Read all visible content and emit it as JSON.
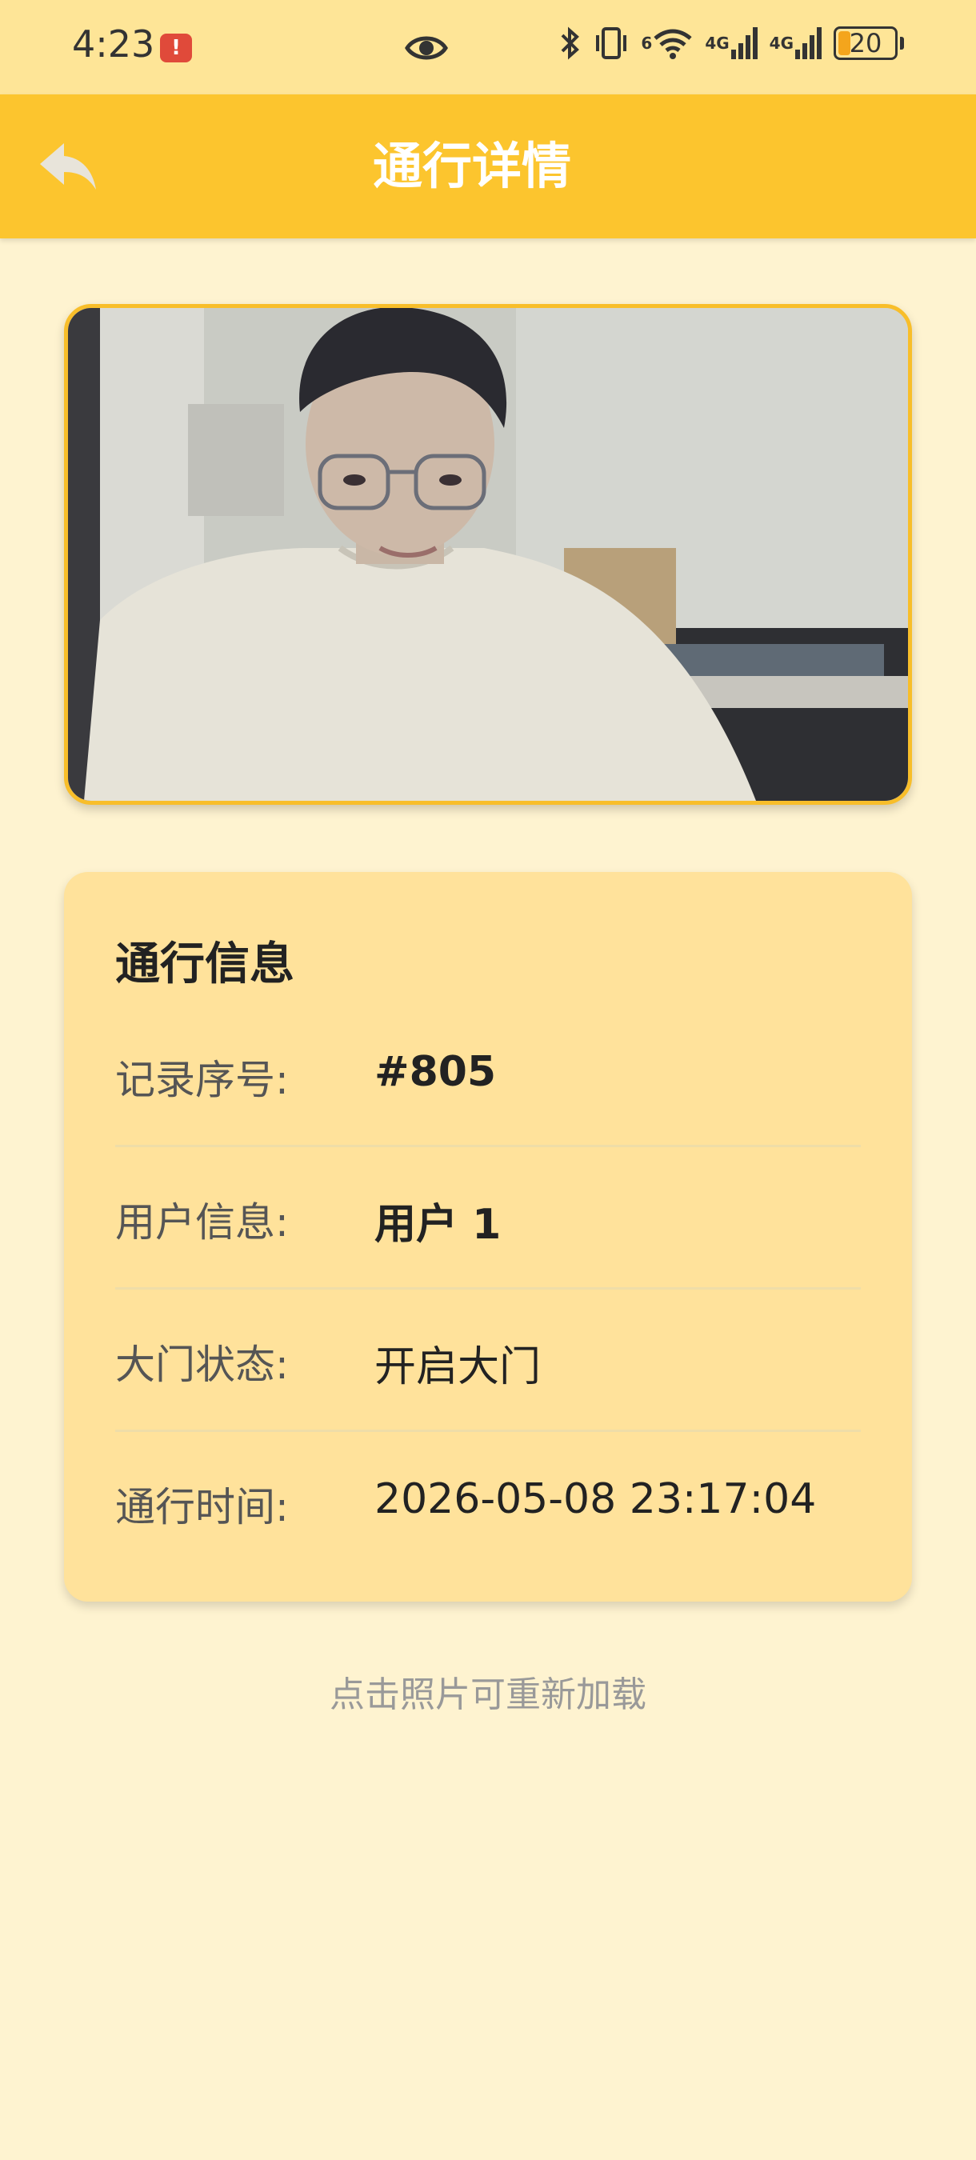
{
  "status_bar": {
    "time": "4:23",
    "alert_badge": "!",
    "net_label_1": "6",
    "net_label_2": "4G",
    "net_label_3": "4G",
    "battery": "20"
  },
  "app_bar": {
    "title": "通行详情"
  },
  "photo": {
    "description_icon": "user-face-photo"
  },
  "info_card": {
    "title": "通行信息",
    "rows": [
      {
        "label": "记录序号:",
        "value": "#805"
      },
      {
        "label": "用户信息:",
        "value": "用户 1"
      },
      {
        "label": "大门状态:",
        "value": "开启大门"
      },
      {
        "label": "通行时间:",
        "value": "2026-05-08 23:17:04"
      }
    ]
  },
  "hint": "点击照片可重新加载",
  "colors": {
    "app_bar": "#FCC52E",
    "status_bar": "#FEE597",
    "background": "#FEF3D0",
    "card": "#FFE29B",
    "accent_border": "#F8BE2A"
  }
}
